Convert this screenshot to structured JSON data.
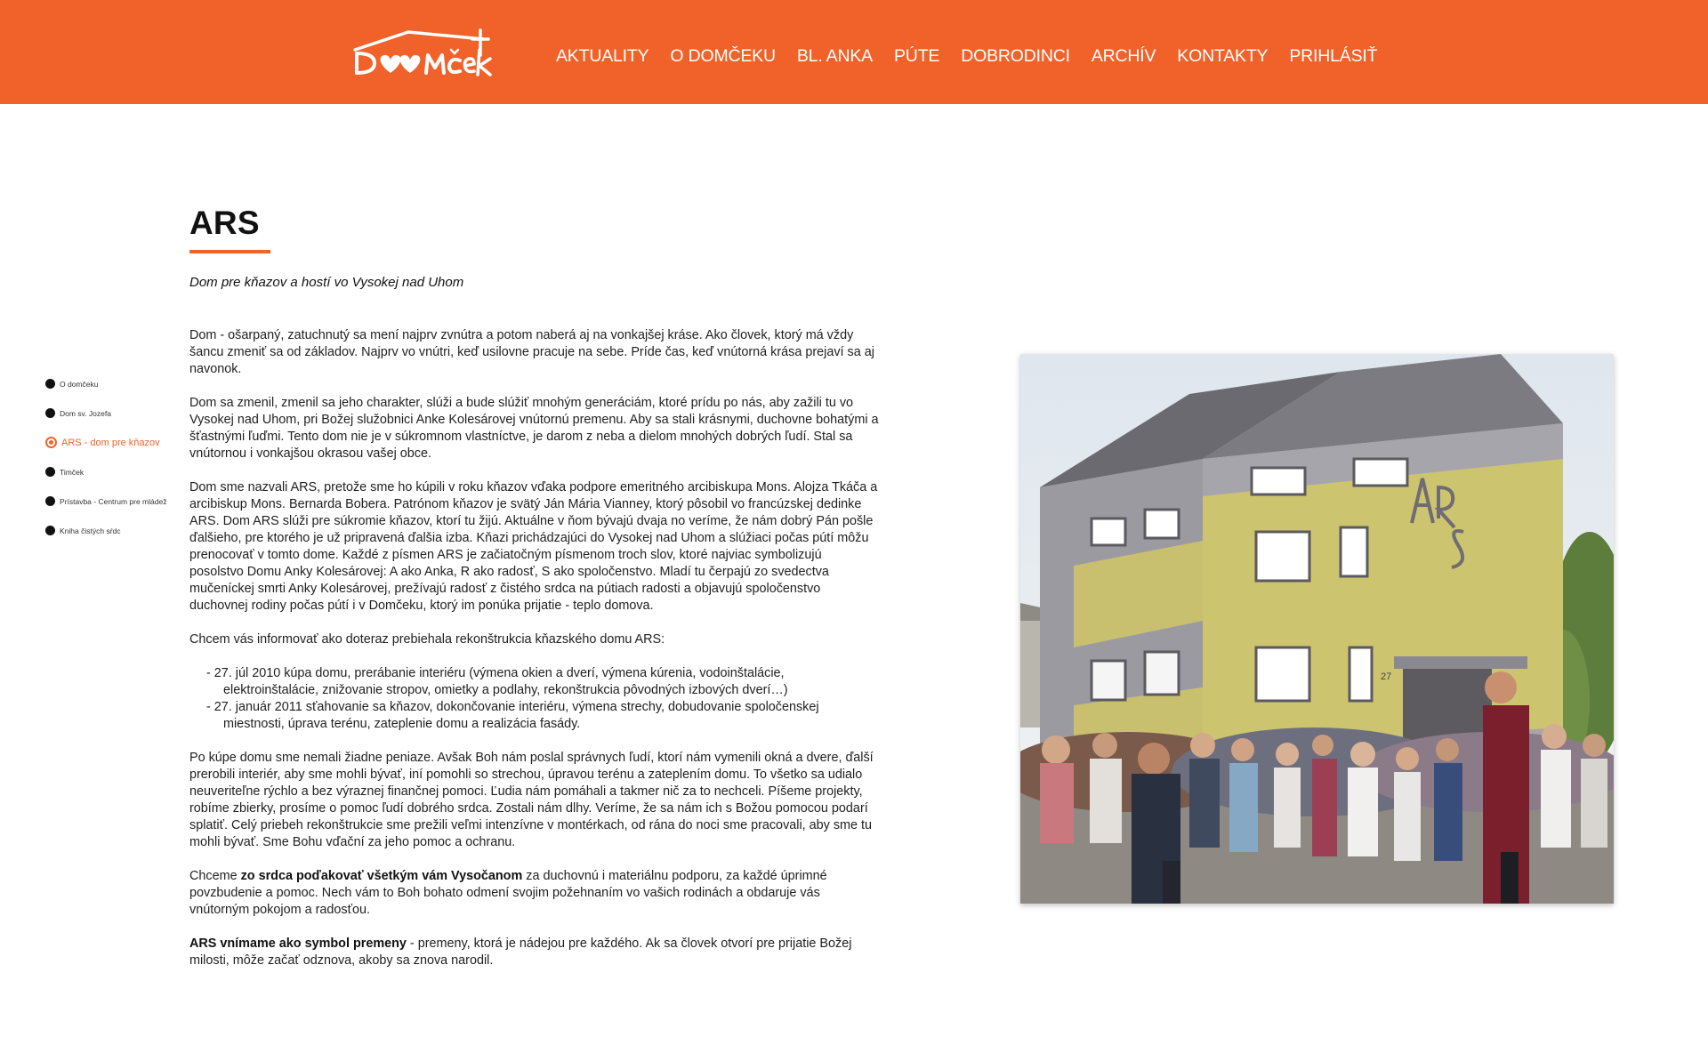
{
  "colors": {
    "brand": "#f0622a",
    "header_text": "#ffffff"
  },
  "header": {
    "logo_text": "Domček",
    "nav": [
      "AKTUALITY",
      "O DOMČEKU",
      "BL. ANKA",
      "PÚTE",
      "DOBRODINCI",
      "ARCHÍV",
      "KONTAKTY",
      "PRIHLÁSIŤ"
    ]
  },
  "side_nav": {
    "items": [
      "O domčeku",
      "Dom sv. Jozefa",
      "ARS - dom pre kňazov",
      "Timček",
      "Prístavba - Centrum pre mládež",
      "Kniha čistých sŕdc"
    ],
    "active_index": 2
  },
  "page": {
    "title": "ARS",
    "subtitle": "Dom pre kňazov a hostí vo Vysokej nad Uhom"
  },
  "content": {
    "p1": "Dom - ošarpaný, zatuchnutý sa mení najprv zvnútra a potom naberá aj na vonkajšej kráse.  Ako človek, ktorý má vždy šancu zmeniť sa od základov. Najprv vo vnútri, keď usilovne pracuje na sebe. Príde čas, keď vnútorná krása prejaví sa aj navonok.",
    "p2": "Dom sa zmenil, zmenil sa jeho charakter, slúži a bude slúžiť mnohým generáciám, ktoré prídu po nás, aby zažili tu vo Vysokej nad Uhom, pri Božej služobnici Anke Kolesárovej vnútornú premenu. Aby sa stali krásnymi, duchovne bohatými a šťastnými ľuďmi. Tento dom nie je v súkromnom vlastníctve, je darom z neba a dielom mnohých dobrých ľudí. Stal sa vnútornou i vonkajšou okrasou vašej obce.",
    "p3": "Dom sme nazvali ARS, pretože sme ho kúpili v roku kňazov vďaka podpore emeritného arcibiskupa Mons. Alojza Tkáča a arcibiskup Mons. Bernarda Bobera. Patrónom kňazov je svätý Ján Mária Vianney, ktorý pôsobil vo francúzskej dedinke ARS. Dom ARS slúži pre súkromie kňazov, ktorí tu žijú. Aktuálne v ňom bývajú dvaja no veríme, že nám dobrý Pán pošle ďalšieho, pre ktorého je už pripravená ďalšia izba. Kňazi prichádzajúci do Vysokej nad Uhom a slúžiaci počas pútí môžu prenocovať v tomto dome. Každé z písmen ARS je začiatočným písmenom troch slov, ktoré najviac symbolizujú posolstvo Domu Anky Kolesárovej: A ako Anka, R ako radosť, S ako spoločenstvo. Mladí tu čerpajú zo svedectva mučeníckej smrti Anky Kolesárovej, prežívajú radosť z čistého srdca na pútiach radosti a objavujú spoločenstvo duchovnej rodiny počas pútí i v Domčeku, ktorý im ponúka prijatie - teplo domova.",
    "p4": "Chcem vás informovať ako doteraz prebiehala rekonštrukcia kňazského domu ARS:",
    "list": [
      "27. júl 2010 kúpa domu, prerábanie interiéru (výmena okien a dverí, výmena kúrenia, vodoinštalácie, elektroinštalácie, znižovanie stropov, omietky a podlahy, rekonštrukcia pôvodných izbových dverí…)",
      "27. január 2011 sťahovanie sa kňazov, dokončovanie interiéru, výmena strechy, dobudovanie spoločenskej miestnosti, úprava terénu, zateplenie domu a realizácia fasády."
    ],
    "p5": "Po kúpe domu sme nemali žiadne peniaze. Avšak Boh nám poslal správnych ľudí, ktorí nám vymenili okná a dvere, ďalší prerobili interiér, aby sme mohli bývať, iní pomohli so strechou, úpravou terénu a zateplením domu. To všetko sa udialo neuveriteľne rýchlo a bez výraznej finančnej pomoci. Ľudia nám pomáhali a takmer nič za to nechceli. Píšeme projekty, robíme zbierky, prosíme o pomoc ľudí dobrého srdca. Zostali nám dlhy. Veríme, že sa nám ich s Božou pomocou podarí splatiť. Celý priebeh rekonštrukcie sme prežili veľmi intenzívne v montérkach, od rána do noci sme pracovali, aby sme tu mohli bývať. Sme Bohu vďační za jeho pomoc a ochranu.",
    "p6_pre": "Chceme ",
    "p6_strong": "zo srdca poďakovať všetkým vám Vysočanom",
    "p6_post": " za duchovnú i materiálnu podporu, za každé úprimné povzbudenie a pomoc. Nech vám to Boh bohato odmení svojim požehnaním vo vašich rodinách a obdaruje vás vnútorným pokojom a radosťou.",
    "p7_strong": "ARS vnímame ako symbol premeny",
    "p7_post": " - premeny, ktorá je nádejou pre každého. Ak sa človek otvorí pre prijatie Božej milosti, môže začať odznova, akoby sa znova narodil."
  },
  "photo": {
    "building_number": "27",
    "facade_monogram": "ARS"
  }
}
